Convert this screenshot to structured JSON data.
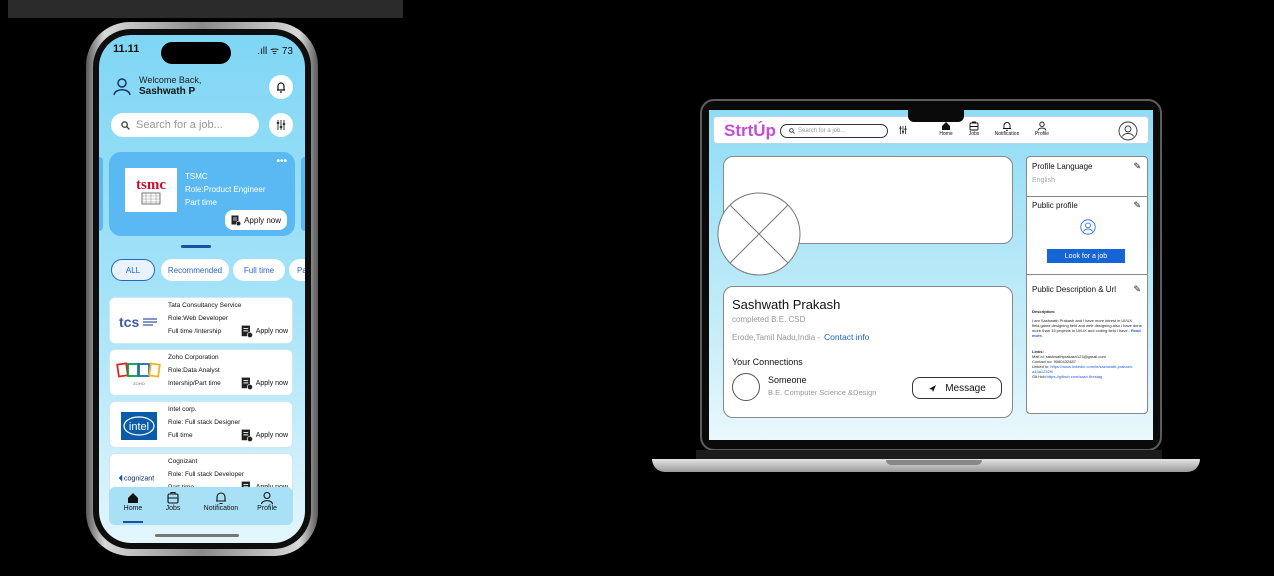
{
  "phone": {
    "status": {
      "time": "11.11",
      "signal": ".ıll ᯤ 73"
    },
    "greeting": {
      "line1": "Welcome Back,",
      "name": "Sashwath P"
    },
    "search": {
      "placeholder": "Search for a job..."
    },
    "featured": {
      "company": "TSMC",
      "role": "Role:Product Engineer",
      "type": "Part time",
      "apply": "Apply now",
      "logo_text": "tsmc",
      "more": "•••"
    },
    "chips": [
      "ALL",
      "Recommended",
      "Full time",
      "Par"
    ],
    "jobs": [
      {
        "company": "Tata Consultancy Service",
        "role": "Role:Web Developer",
        "type": "Full time /Intership",
        "apply": "Apply now",
        "logo": "tcs"
      },
      {
        "company": "Zoho Corporation",
        "role": "Role:Data Analyst",
        "type": "Intership/Part time",
        "apply": "Apply now",
        "logo": "ZOHO"
      },
      {
        "company": "Intel corp.",
        "role": "Role: Full stack Designer",
        "type": "Full time",
        "apply": "Apply now",
        "logo": "intel"
      },
      {
        "company": "Cognizant",
        "role": "Role: Full stack Developer",
        "type": "Part time",
        "apply": "Apply now",
        "logo": "cognizant"
      }
    ],
    "tabs": [
      "Home",
      "Jobs",
      "Notification",
      "Profile"
    ]
  },
  "laptop": {
    "brand": "StrtÚp",
    "search_placeholder": "Search for a job...",
    "tabs": [
      "Home",
      "Jobs",
      "Notification",
      "Profile"
    ],
    "profile": {
      "name": "Sashwath Prakash",
      "education": "completed B.E. CSD",
      "location": "Erode,Tamil Nadu,India -",
      "contact_info": "Contact info",
      "connections_heading": "Your Connections",
      "connection_name": "Someone",
      "connection_desc": "B.E. Computer Science &Design",
      "message": "Message"
    },
    "sidebar": {
      "language_heading": "Profile Language",
      "language_value": "English",
      "public_profile_heading": "Public profile",
      "look_for_job": "Look for a job",
      "desc_heading": "Public Description & Url",
      "desc_label": "Description:",
      "desc_text": "I am Sashwath Prakash and i have more intrest in UI/UX field,game designing field and web designing.also i have done more than 15 projects in UI/UX and coding field i have..",
      "read_more": "Read more.",
      "links_label": "Links:",
      "mail": "Mail id: sashwathprakash123@gmail.com",
      "contact": "Contact no: 9080432487",
      "linkedin_prefix": "Linked in:",
      "linkedin": "https://www.linkedin.com/in/sashwath-prakash-a44a12329/",
      "git_prefix": "Git Hub:",
      "github": "https://github.com/sash-firestag"
    }
  },
  "colors": {
    "accent": "#1565d8",
    "brand": "#c44cd8",
    "sky": "#8fdcf6"
  }
}
